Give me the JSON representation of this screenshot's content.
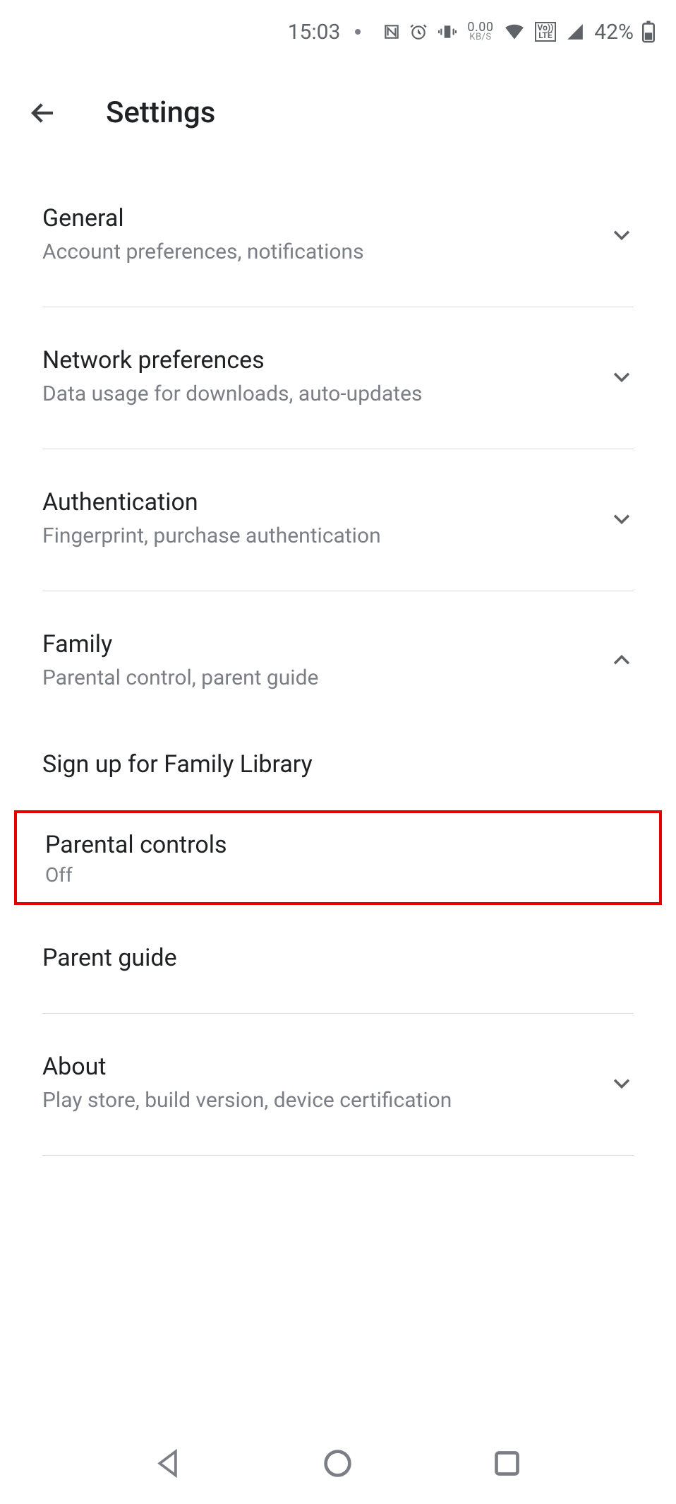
{
  "statusBar": {
    "time": "15:03",
    "dataTop": "0.00",
    "dataBottom": "KB/S",
    "volteTop": "Vo))",
    "volteBottom": "LTE",
    "batteryPct": "42%"
  },
  "appBar": {
    "title": "Settings"
  },
  "items": {
    "general": {
      "title": "General",
      "subtitle": "Account preferences, notifications"
    },
    "network": {
      "title": "Network preferences",
      "subtitle": "Data usage for downloads, auto-updates"
    },
    "auth": {
      "title": "Authentication",
      "subtitle": "Fingerprint, purchase authentication"
    },
    "family": {
      "title": "Family",
      "subtitle": "Parental control, parent guide"
    },
    "familyLibrary": {
      "title": "Sign up for Family Library"
    },
    "parentalControls": {
      "title": "Parental controls",
      "status": "Off"
    },
    "parentGuide": {
      "title": "Parent guide"
    },
    "about": {
      "title": "About",
      "subtitle": "Play store, build version, device certification"
    }
  }
}
